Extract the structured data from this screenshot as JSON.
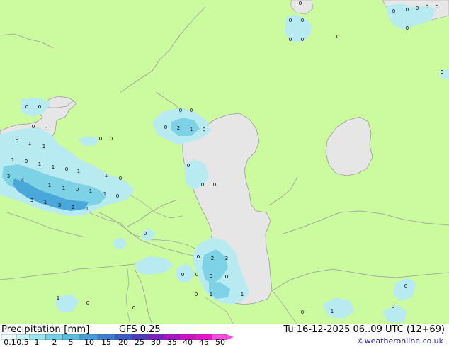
{
  "header": {
    "title": "Precipitation [mm]",
    "model": "GFS 0.25",
    "valid_time": "Tu 16-12-2025 06..09 UTC (12+69)",
    "credit": "©weatheronline.co.uk"
  },
  "legend": {
    "tick_labels": [
      "0.1",
      "0.5",
      "1",
      "2",
      "5",
      "10",
      "15",
      "20",
      "25",
      "30",
      "35",
      "40",
      "45",
      "50"
    ],
    "colors": [
      "#eefbfb",
      "#c7f1f4",
      "#9ae4ee",
      "#72d3e8",
      "#58c1e1",
      "#459fd8",
      "#3b7fd0",
      "#3a5cc6",
      "#4b3abc",
      "#7723c2",
      "#a616c6",
      "#d10fc8",
      "#ec11d2",
      "#f54fe0"
    ]
  },
  "colors": {
    "land": "#ccfa9f",
    "water": "#e6e6e6",
    "border": "#a0a0a0",
    "precip_light": "#b8eaf1",
    "precip_medium": "#7ed2e6",
    "precip_heavy": "#4aa7d9"
  },
  "map_labels": [
    "0",
    "0",
    "0",
    "0",
    "0",
    "0",
    "0",
    "0",
    "0",
    "0",
    "0",
    "0",
    "0",
    "0",
    "0",
    "0",
    "0",
    "0",
    "0",
    "1",
    "1",
    "0",
    "0",
    "0",
    "1",
    "0",
    "0",
    "2",
    "1",
    "0",
    "0",
    "0",
    "0",
    "1",
    "0",
    "0",
    "1",
    "1",
    "0",
    "1",
    "1",
    "1",
    "1",
    "0",
    "3",
    "1",
    "1",
    "1",
    "0",
    "1",
    "3",
    "1",
    "3",
    "2",
    "1",
    "1",
    "0",
    "0",
    "0",
    "0",
    "0",
    "2",
    "2",
    "0",
    "0",
    "0",
    "0",
    "0",
    "1",
    "0",
    "1",
    "1",
    "0",
    "0",
    "0",
    "1",
    "0",
    "0",
    "0"
  ]
}
